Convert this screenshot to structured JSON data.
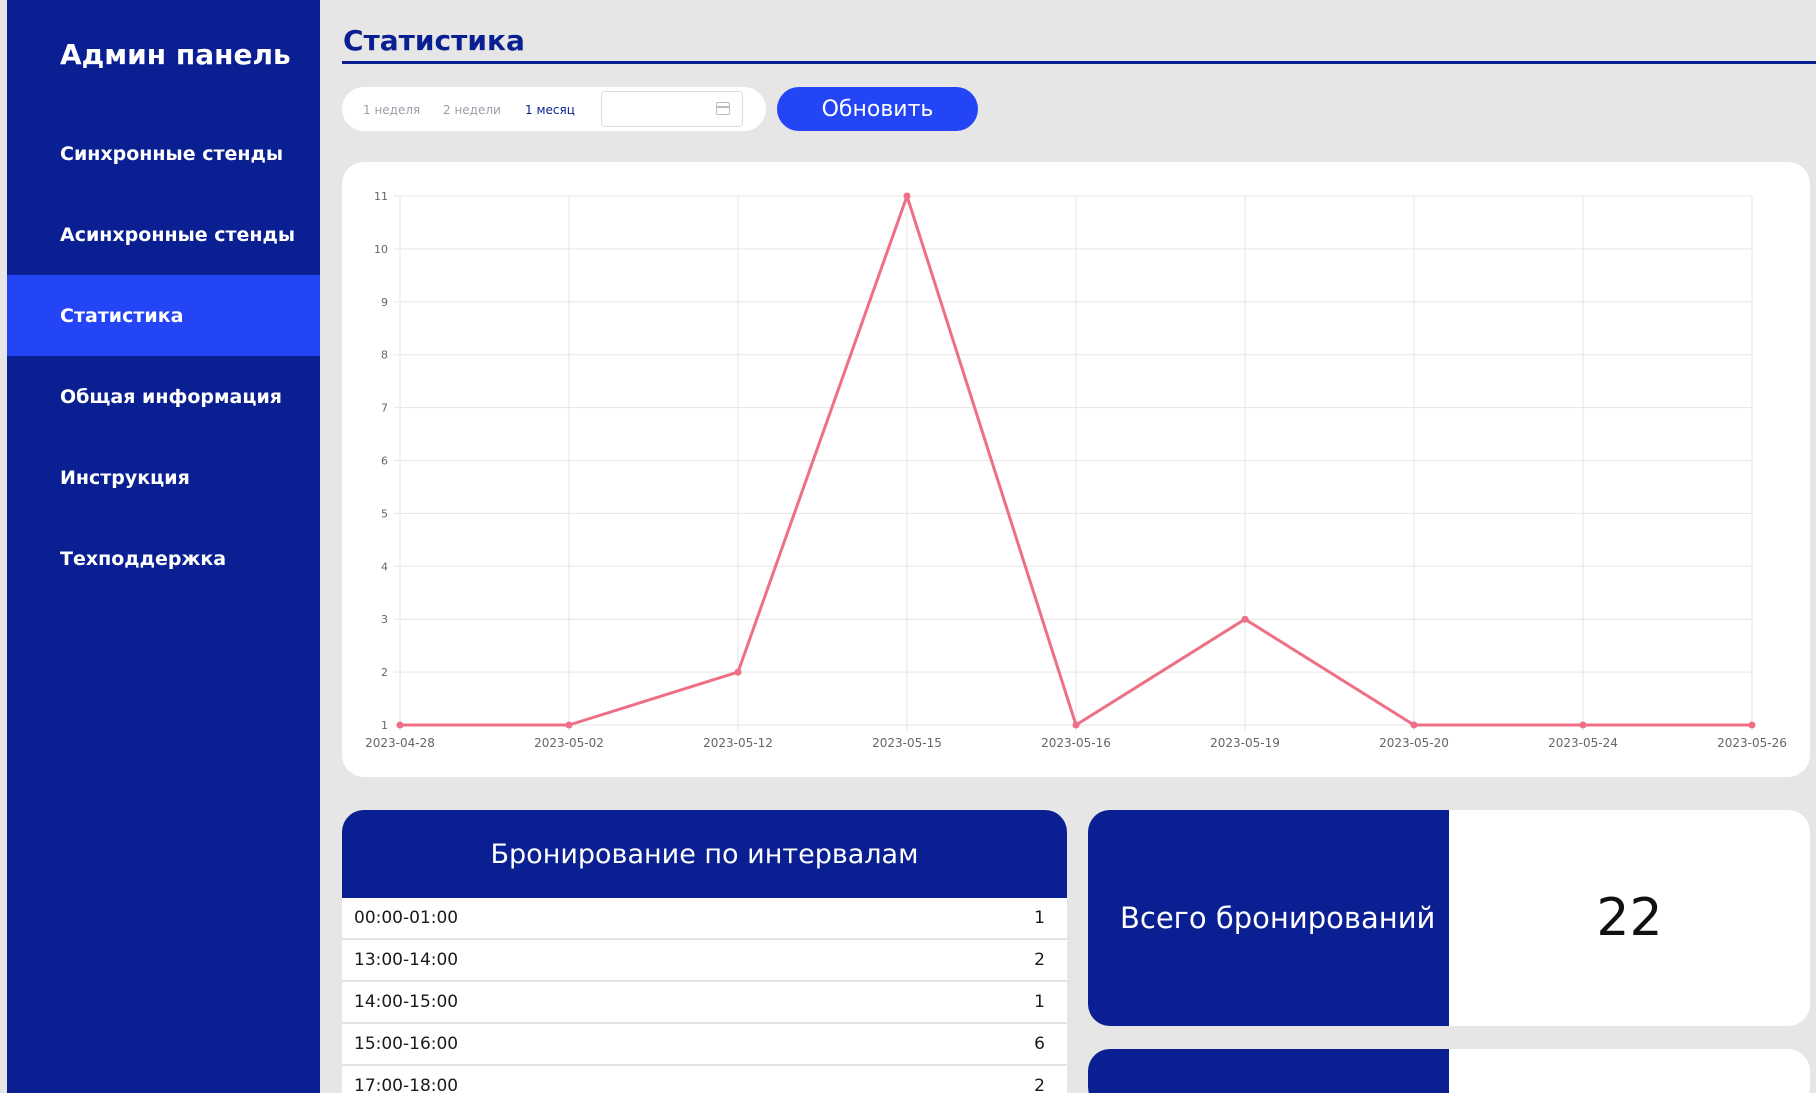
{
  "sidebar": {
    "brand": "Админ панель",
    "items": [
      {
        "label": "Синхронные стенды"
      },
      {
        "label": "Асинхронные стенды"
      },
      {
        "label": "Статистика"
      },
      {
        "label": "Общая информация"
      },
      {
        "label": "Инструкция"
      },
      {
        "label": "Техподдержка"
      }
    ],
    "active_index": 2
  },
  "header": {
    "title": "Статистика"
  },
  "filters": {
    "periods": [
      {
        "label": "1 неделя"
      },
      {
        "label": "2 недели"
      },
      {
        "label": "1 месяц"
      }
    ],
    "active_index": 2,
    "date_value": "",
    "refresh_label": "Обновить"
  },
  "chart_data": {
    "type": "line",
    "x": [
      "2023-04-28",
      "2023-05-02",
      "2023-05-12",
      "2023-05-15",
      "2023-05-16",
      "2023-05-19",
      "2023-05-20",
      "2023-05-24",
      "2023-05-26"
    ],
    "series": [
      {
        "values": [
          1,
          1,
          2,
          11,
          1,
          3,
          1,
          1,
          1
        ],
        "color": "#ee6f86"
      }
    ],
    "yticks": [
      1,
      2,
      3,
      4,
      5,
      6,
      7,
      8,
      9,
      10,
      11
    ],
    "ylim": [
      1,
      11
    ],
    "grid": true,
    "title": "",
    "xlabel": "",
    "ylabel": ""
  },
  "intervals": {
    "title": "Бронирование по интервалам",
    "rows": [
      {
        "range": "00:00-01:00",
        "count": "1"
      },
      {
        "range": "13:00-14:00",
        "count": "2"
      },
      {
        "range": "14:00-15:00",
        "count": "1"
      },
      {
        "range": "15:00-16:00",
        "count": "6"
      },
      {
        "range": "17:00-18:00",
        "count": "2"
      }
    ]
  },
  "stats": {
    "total_label": "Всего бронирований",
    "total_value": "22"
  },
  "colors": {
    "primary": "#0a1f91",
    "accent": "#2445f5",
    "line": "#ee6f86",
    "background": "#e6e6e6"
  }
}
